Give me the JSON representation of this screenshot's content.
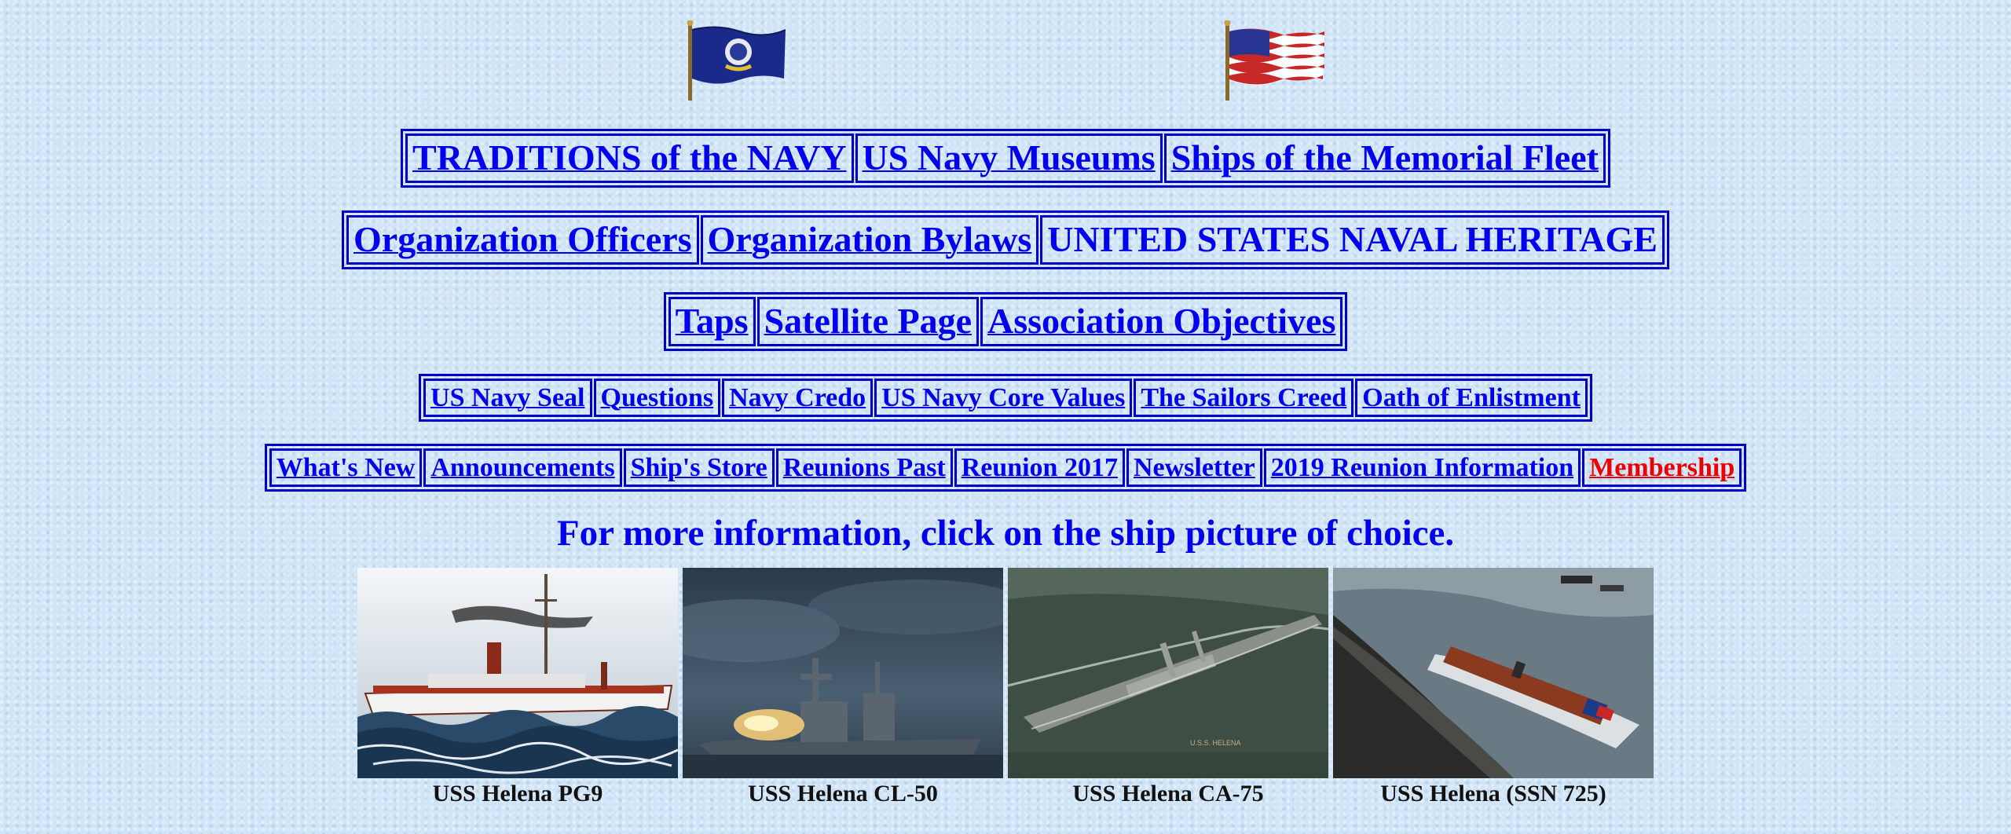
{
  "flags": [
    {
      "name": "navy-flag-icon"
    },
    {
      "name": "us-flag-icon"
    }
  ],
  "nav": {
    "row1": [
      "TRADITIONS of the NAVY",
      "US Navy Museums",
      "Ships of the Memorial Fleet"
    ],
    "row2": [
      "Organization Officers",
      "Organization Bylaws",
      "UNITED STATES NAVAL HERITAGE"
    ],
    "row3": [
      "Taps",
      "Satellite Page",
      "Association Objectives"
    ],
    "row4": [
      "US Navy Seal",
      "Questions",
      "Navy Credo",
      "US Navy Core Values",
      "The Sailors Creed",
      "Oath of Enlistment"
    ],
    "row5": [
      "What's New",
      "Announcements",
      "Ship's Store",
      "Reunions Past",
      "Reunion 2017",
      "Newsletter",
      "2019 Reunion Information",
      "Membership"
    ]
  },
  "prompt": "For more information, click on the ship picture of choice.",
  "ships": [
    {
      "caption": "USS Helena PG9"
    },
    {
      "caption": "USS Helena CL-50"
    },
    {
      "caption": "USS Helena CA-75",
      "hull_marking": "U.S.S. HELENA"
    },
    {
      "caption": "USS Helena (SSN 725)"
    }
  ],
  "colors": {
    "link": "#0000ee",
    "border": "#0000cc",
    "membership": "#ee0000",
    "background": "#cfe4f6"
  }
}
